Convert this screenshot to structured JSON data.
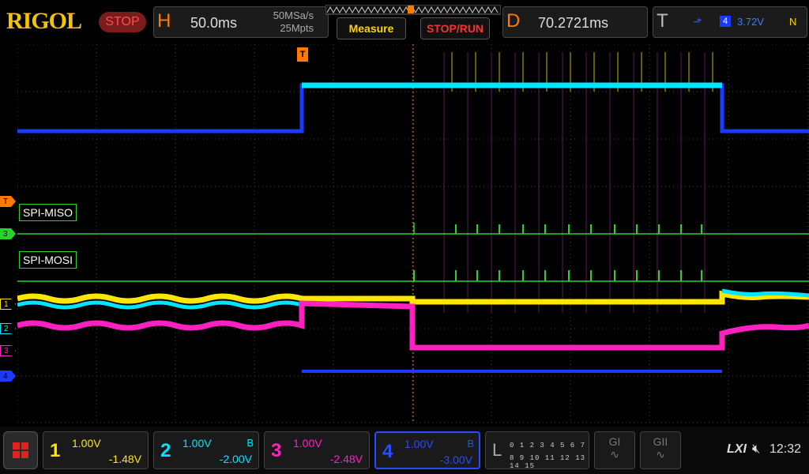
{
  "brand": {
    "logo": "RIGOL",
    "run_state": "STOP"
  },
  "horizontal": {
    "tag": "H",
    "timebase": "50.0ms",
    "sample_rate": "50MSa/s",
    "memory_depth": "25Mpts"
  },
  "buttons": {
    "measure": "Measure",
    "stop_run": "STOP/RUN"
  },
  "delay": {
    "tag": "D",
    "value": "70.2721ms"
  },
  "trigger": {
    "tag": "T",
    "edge_icon": "rising-edge-icon",
    "source": "4",
    "level": "3.72V",
    "mode": "N"
  },
  "decode_labels": {
    "miso": "SPI-MISO",
    "mosi": "SPI-MOSI"
  },
  "markers": {
    "trigger_level": "T",
    "trigger_top": "T",
    "d3": "3",
    "ch1": "1",
    "ch2": "2",
    "ch3": "3",
    "ch4": "4"
  },
  "channels": [
    {
      "num": "1",
      "scale": "1.00V",
      "bw": "",
      "offset": "-1.48V",
      "color": "#ffe600"
    },
    {
      "num": "2",
      "scale": "1.00V",
      "bw": "B",
      "offset": "-2.00V",
      "color": "#00e5ff"
    },
    {
      "num": "3",
      "scale": "1.00V",
      "bw": "",
      "offset": "-2.48V",
      "color": "#ff20c0"
    },
    {
      "num": "4",
      "scale": "1.00V",
      "bw": "B",
      "offset": "-3.00V",
      "color": "#1a3aff"
    }
  ],
  "logic": {
    "tag": "L",
    "row1": "0 1 2 3  4 5 6 7",
    "row2": "8 9 10 11 12 13 14 15"
  },
  "generators": {
    "g1": "GI",
    "g2": "GII"
  },
  "status": {
    "lxi": "LXI",
    "time": "12:32"
  }
}
